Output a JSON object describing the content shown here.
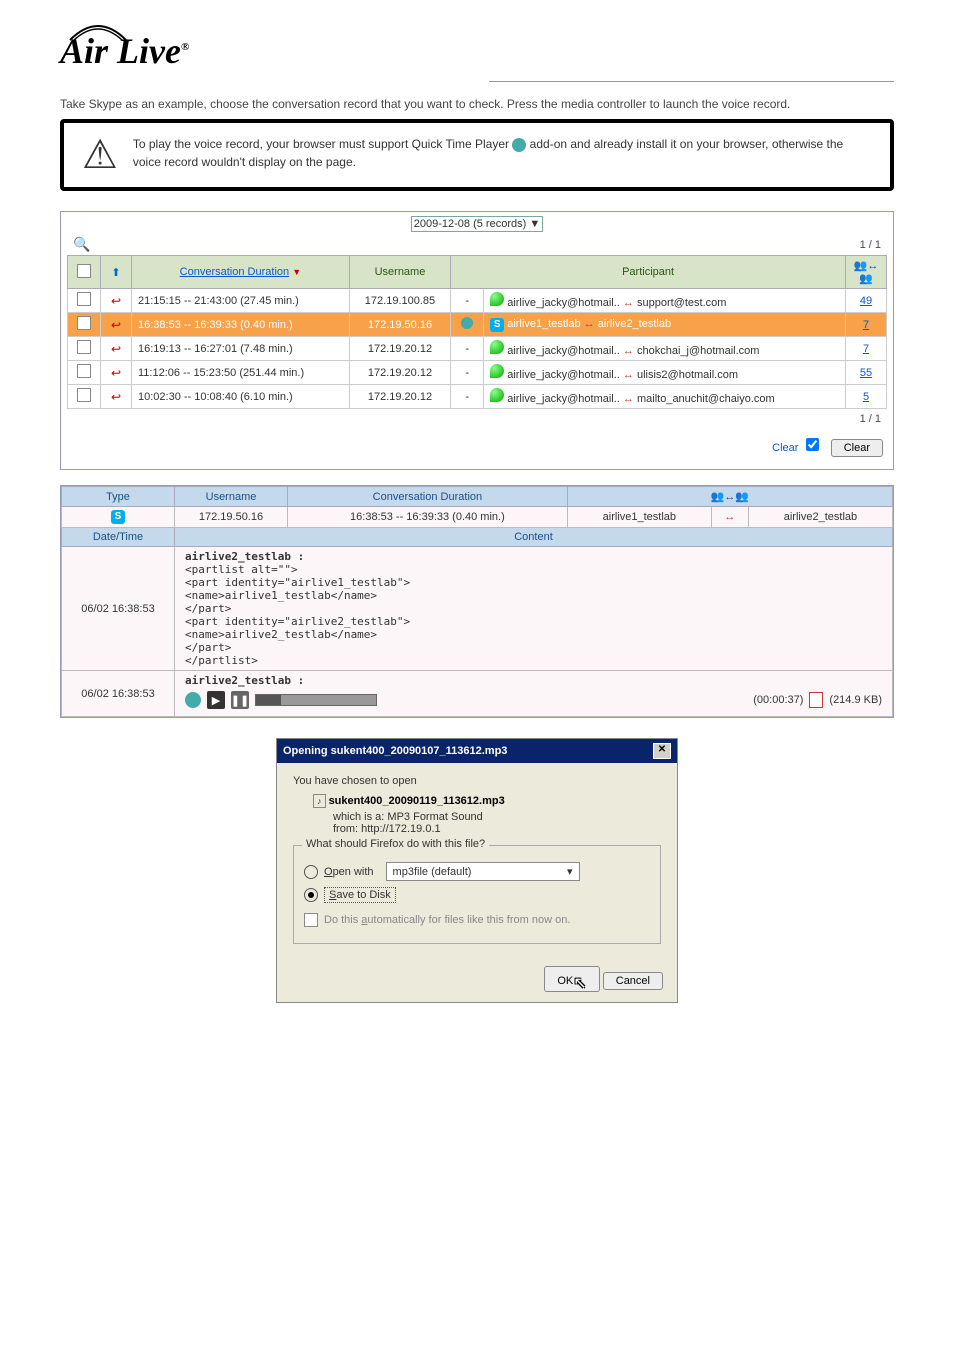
{
  "logo": "Air Live",
  "note": "Take Skype as an example, choose the conversation record that you want to check. Press the media controller to launch the voice record.",
  "caution": "To play the voice record, your browser must support Quick Time Player © add-on and already install it on your browser, otherwise the voice record wouldn't display on the page.",
  "records_panel": {
    "dropdown": "2009-12-08 (5 records)",
    "pager": "1 / 1",
    "headers": {
      "duration": "Conversation Duration",
      "username": "Username",
      "participant": "Participant"
    },
    "rows": [
      {
        "duration": "21:15:15 -- 21:43:00 (27.45 min.)",
        "username": "172.19.100.85",
        "dash": "-",
        "p1": "airlive_jacky@hotmail..",
        "p2": "support@test.com",
        "count": "49"
      },
      {
        "duration": "16:38:53 -- 16:39:33 (0.40 min.)",
        "username": "172.19.50.16",
        "dash": "",
        "p1": "airlive1_testlab",
        "p2": "airlive2_testlab",
        "count": "7",
        "hl": true
      },
      {
        "duration": "16:19:13 -- 16:27:01 (7.48 min.)",
        "username": "172.19.20.12",
        "dash": "-",
        "p1": "airlive_jacky@hotmail..",
        "p2": "chokchai_j@hotmail.com",
        "count": "7"
      },
      {
        "duration": "11:12:06 -- 15:23:50 (251.44 min.)",
        "username": "172.19.20.12",
        "dash": "-",
        "p1": "airlive_jacky@hotmail..",
        "p2": "ulisis2@hotmail.com",
        "count": "55"
      },
      {
        "duration": "10:02:30 -- 10:08:40 (6.10 min.)",
        "username": "172.19.20.12",
        "dash": "-",
        "p1": "airlive_jacky@hotmail..",
        "p2": "mailto_anuchit@chaiyo.com",
        "count": "5"
      }
    ],
    "clear_label": "Clear",
    "clear_button": "Clear"
  },
  "detail_panel": {
    "headers": {
      "type": "Type",
      "username": "Username",
      "duration": "Conversation Duration",
      "participants_icon": "↔"
    },
    "row": {
      "username": "172.19.50.16",
      "duration": "16:38:53 -- 16:39:33 (0.40 min.)",
      "p1": "airlive1_testlab",
      "p2": "airlive2_testlab"
    },
    "sub_headers": {
      "datetime": "Date/Time",
      "content": "Content"
    },
    "content_rows": [
      {
        "datetime": "06/02 16:38:53",
        "title": "airlive2_testlab :",
        "lines": [
          "<partlist alt=\"\">",
          "  <part identity=\"airlive1_testlab\">",
          "    <name>airlive1_testlab</name>",
          "  </part>",
          "  <part identity=\"airlive2_testlab\">",
          "    <name>airlive2_testlab</name>",
          "  </part>",
          "</partlist>"
        ]
      },
      {
        "datetime": "06/02 16:38:53",
        "title": "airlive2_testlab :",
        "media": {
          "time": "(00:00:37)",
          "size": "(214.9 KB)"
        }
      }
    ]
  },
  "dialog": {
    "title": "Opening sukent400_20090107_113612.mp3",
    "chosen": "You have chosen to open",
    "filename": "sukent400_20090119_113612.mp3",
    "which_is": "which is a:",
    "file_type": "MP3 Format Sound",
    "from_lbl": "from:",
    "from_val": "http://172.19.0.1",
    "legend": "What should Firefox do with this file?",
    "open_with": "Open with",
    "open_app": "mp3file (default)",
    "save_disk": "Save to Disk",
    "auto": "Do this automatically for files like this from now on.",
    "ok": "OK",
    "cancel": "Cancel"
  }
}
